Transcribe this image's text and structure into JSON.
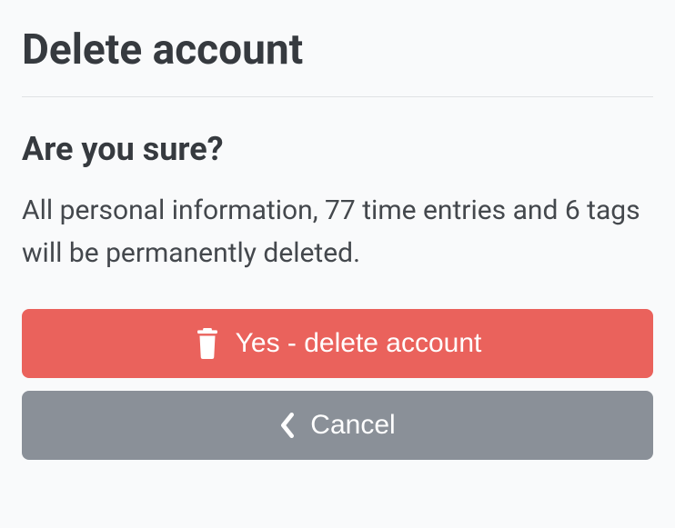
{
  "title": "Delete account",
  "confirm": {
    "heading": "Are you sure?",
    "body": "All personal information, 77 time entries and 6 tags will be permanently deleted."
  },
  "buttons": {
    "delete_label": "Yes - delete account",
    "cancel_label": "Cancel"
  }
}
